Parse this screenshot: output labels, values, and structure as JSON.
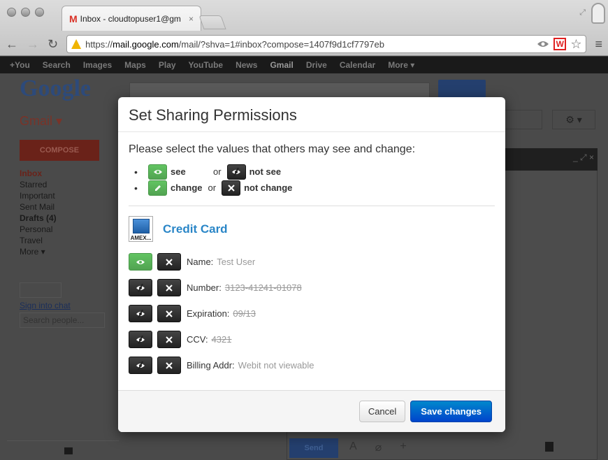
{
  "browser": {
    "tab_title": "Inbox - cloudtopuser1@gm",
    "tab_close": "×",
    "url_scheme": "https://",
    "url_host": "mail.google.com",
    "url_rest": "/mail/?shva=1#inbox?compose=1407f9d1cf7797eb",
    "ext_label": "W"
  },
  "gbar": {
    "items": [
      "+You",
      "Search",
      "Images",
      "Maps",
      "Play",
      "YouTube",
      "News",
      "Gmail",
      "Drive",
      "Calendar",
      "More ▾"
    ]
  },
  "gmail": {
    "logo": "Google",
    "label": "Gmail ▾",
    "compose": "COMPOSE",
    "folders": {
      "inbox": "Inbox",
      "starred": "Starred",
      "important": "Important",
      "sent": "Sent Mail",
      "drafts": "Drafts (4)",
      "personal": "Personal",
      "travel": "Travel",
      "more": "More ▾"
    },
    "sign_in_chat": "Sign into chat",
    "search_people_placeholder": "Search people...",
    "send": "Send"
  },
  "modal": {
    "title": "Set Sharing Permissions",
    "intro": "Please select the values that others may see and change:",
    "legend": {
      "see": "see",
      "or1": "or",
      "not_see": "not see",
      "change": "change",
      "or2": "or",
      "not_change": "not change"
    },
    "card_title": "Credit Card",
    "card_logo_text": "AMEX...",
    "fields": [
      {
        "label": "Name:",
        "value": "Test User",
        "visible": true
      },
      {
        "label": "Number:",
        "value": "3123-41241-01078",
        "visible": false
      },
      {
        "label": "Expiration:",
        "value": "09/13",
        "visible": false
      },
      {
        "label": "CCV:",
        "value": "4321",
        "visible": false
      },
      {
        "label": "Billing Addr:",
        "value": "Webit not viewable",
        "visible": false
      }
    ],
    "cancel": "Cancel",
    "save": "Save changes"
  },
  "colors": {
    "green": "#5bb75b",
    "black": "#222222",
    "primary": "#0066cc",
    "link": "#2a86c7"
  }
}
